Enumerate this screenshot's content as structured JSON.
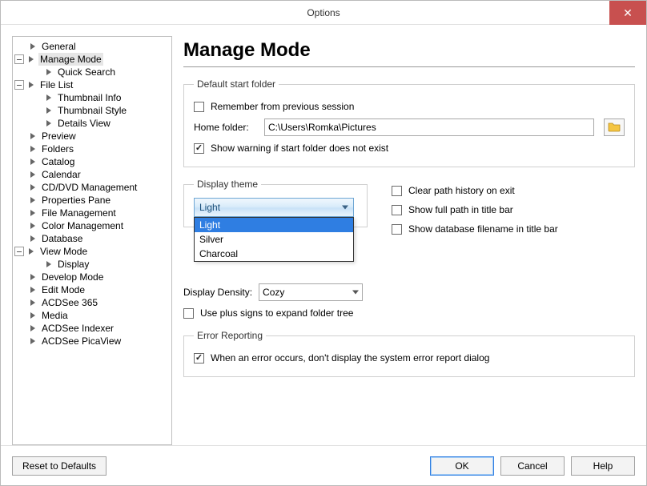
{
  "window": {
    "title": "Options"
  },
  "tree": {
    "items": [
      {
        "label": "General"
      },
      {
        "label": "Manage Mode",
        "selected": true
      },
      {
        "label": "Quick Search"
      },
      {
        "label": "File List"
      },
      {
        "label": "Thumbnail Info"
      },
      {
        "label": "Thumbnail Style"
      },
      {
        "label": "Details View"
      },
      {
        "label": "Preview"
      },
      {
        "label": "Folders"
      },
      {
        "label": "Catalog"
      },
      {
        "label": "Calendar"
      },
      {
        "label": "CD/DVD Management"
      },
      {
        "label": "Properties Pane"
      },
      {
        "label": "File Management"
      },
      {
        "label": "Color Management"
      },
      {
        "label": "Database"
      },
      {
        "label": "View Mode"
      },
      {
        "label": "Display"
      },
      {
        "label": "Develop Mode"
      },
      {
        "label": "Edit Mode"
      },
      {
        "label": "ACDSee 365"
      },
      {
        "label": "Media"
      },
      {
        "label": "ACDSee Indexer"
      },
      {
        "label": "ACDSee PicaView"
      }
    ]
  },
  "page": {
    "title": "Manage Mode",
    "start_folder": {
      "legend": "Default start folder",
      "remember_label": "Remember from previous session",
      "remember_checked": false,
      "home_label": "Home folder:",
      "home_value": "C:\\Users\\Romka\\Pictures",
      "warn_label": "Show warning if start folder does not exist",
      "warn_checked": true
    },
    "display_theme": {
      "legend": "Display theme",
      "selected": "Light",
      "options_0": "Light",
      "options_1": "Silver",
      "options_2": "Charcoal"
    },
    "path_opts": {
      "clear_label": "Clear path history on exit",
      "fullpath_label": "Show full path in title bar",
      "dbfilename_label": "Show database filename in title bar"
    },
    "density": {
      "label": "Display Density:",
      "value": "Cozy",
      "plus_label": "Use plus signs to expand folder tree"
    },
    "error": {
      "legend": "Error Reporting",
      "suppress_label": "When an error occurs, don't display the system error report dialog",
      "suppress_checked": true
    }
  },
  "buttons": {
    "reset": "Reset to Defaults",
    "ok": "OK",
    "cancel": "Cancel",
    "help": "Help"
  }
}
